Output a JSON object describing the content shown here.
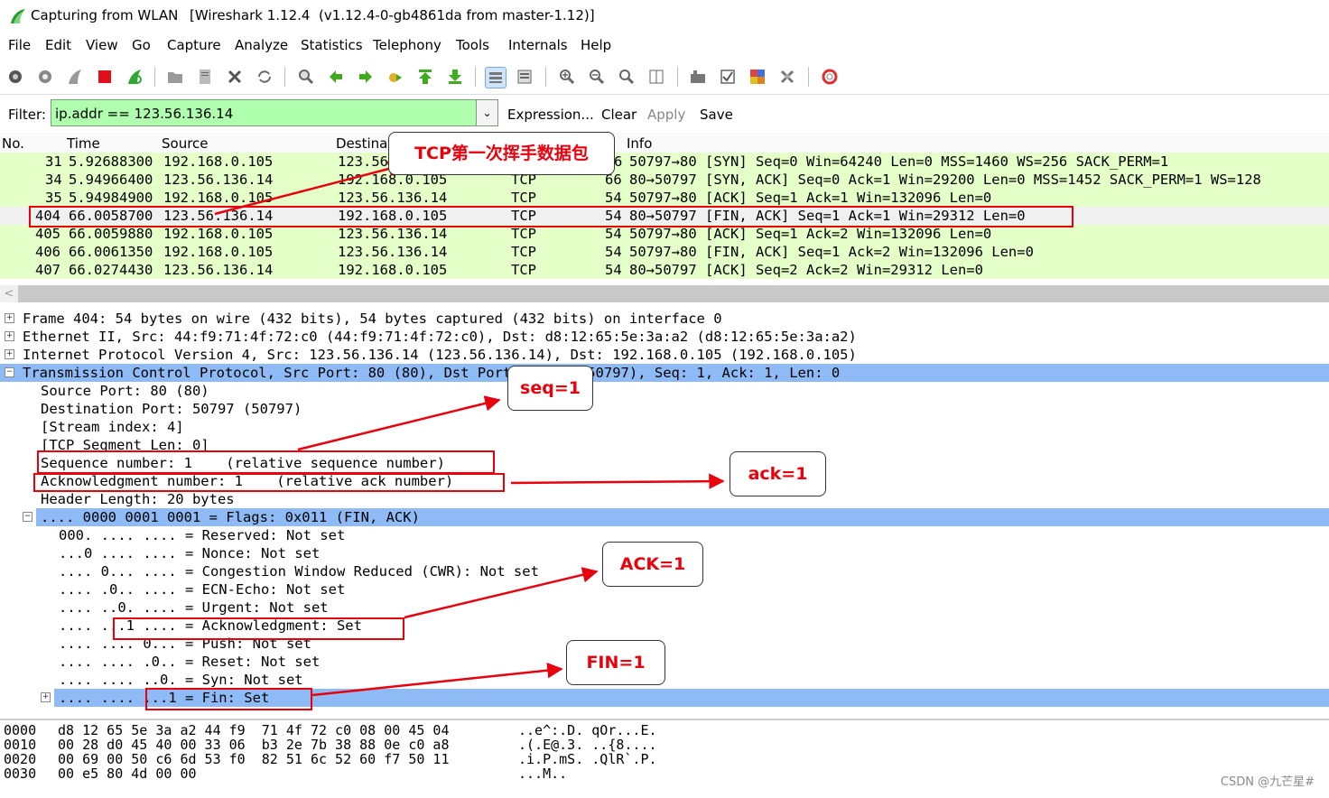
{
  "window": {
    "title_left": "Capturing from WLAN",
    "title_right": "[Wireshark 1.12.4  (v1.12.4-0-gb4861da from master-1.12)]"
  },
  "menu": [
    "File",
    "Edit",
    "View",
    "Go",
    "Capture",
    "Analyze",
    "Statistics",
    "Telephony",
    "Tools",
    "Internals",
    "Help"
  ],
  "filter": {
    "label": "Filter:",
    "value": "ip.addr == 123.56.136.14",
    "links": [
      "Expression...",
      "Clear",
      "Apply",
      "Save"
    ]
  },
  "packet_list": {
    "headers": [
      "No.",
      "Time",
      "Source",
      "Destinat",
      "Info"
    ],
    "rows": [
      {
        "no": "31",
        "time": "5.92688300",
        "src": "192.168.0.105",
        "dst": "123.56",
        "proto": "",
        "len": "6",
        "info": "50797→80 [SYN] Seq=0 Win=64240 Len=0 MSS=1460 WS=256 SACK_PERM=1"
      },
      {
        "no": "34",
        "time": "5.94966400",
        "src": "123.56.136.14",
        "dst": "192.168.0.105",
        "proto": "TCP",
        "len": "66",
        "info": "80→50797 [SYN, ACK] Seq=0 Ack=1 Win=29200 Len=0 MSS=1452 SACK_PERM=1 WS=128"
      },
      {
        "no": "35",
        "time": "5.94984900",
        "src": "192.168.0.105",
        "dst": "123.56.136.14",
        "proto": "TCP",
        "len": "54",
        "info": "50797→80 [ACK] Seq=1 Ack=1 Win=132096 Len=0"
      },
      {
        "no": "404",
        "time": "66.0058700",
        "src": "123.56.136.14",
        "dst": "192.168.0.105",
        "proto": "TCP",
        "len": "54",
        "info": "80→50797 [FIN, ACK] Seq=1 Ack=1 Win=29312 Len=0"
      },
      {
        "no": "405",
        "time": "66.0059880",
        "src": "192.168.0.105",
        "dst": "123.56.136.14",
        "proto": "TCP",
        "len": "54",
        "info": "50797→80 [ACK] Seq=1 Ack=2 Win=132096 Len=0"
      },
      {
        "no": "406",
        "time": "66.0061350",
        "src": "192.168.0.105",
        "dst": "123.56.136.14",
        "proto": "TCP",
        "len": "54",
        "info": "50797→80 [FIN, ACK] Seq=1 Ack=2 Win=132096 Len=0"
      },
      {
        "no": "407",
        "time": "66.0274430",
        "src": "123.56.136.14",
        "dst": "192.168.0.105",
        "proto": "TCP",
        "len": "54",
        "info": "80→50797 [ACK] Seq=2 Ack=2 Win=29312 Len=0"
      }
    ]
  },
  "details": [
    {
      "text": "Frame 404: 54 bytes on wire (432 bits), 54 bytes captured (432 bits) on interface 0",
      "expander": "+"
    },
    {
      "text": "Ethernet II, Src: 44:f9:71:4f:72:c0 (44:f9:71:4f:72:c0), Dst: d8:12:65:5e:3a:a2 (d8:12:65:5e:3a:a2)",
      "expander": "+"
    },
    {
      "text": "Internet Protocol Version 4, Src: 123.56.136.14 (123.56.136.14), Dst: 192.168.0.105 (192.168.0.105)",
      "expander": "+"
    },
    {
      "text": "Transmission Control Protocol, Src Port: 80 (80), Dst Port: 50797 (50797), Seq: 1, Ack: 1, Len: 0",
      "expander": "−"
    },
    {
      "text": "Source Port: 80 (80)"
    },
    {
      "text": "Destination Port: 50797 (50797)"
    },
    {
      "text": "[Stream index: 4]"
    },
    {
      "text": "[TCP Segment Len: 0]"
    },
    {
      "text": "Sequence number: 1    (relative sequence number)"
    },
    {
      "text": "Acknowledgment number: 1    (relative ack number)"
    },
    {
      "text": "Header Length: 20 bytes"
    },
    {
      "text": ".... 0000 0001 0001 = Flags: 0x011 (FIN, ACK)",
      "expander": "−"
    },
    {
      "text": "000. .... .... = Reserved: Not set"
    },
    {
      "text": "...0 .... .... = Nonce: Not set"
    },
    {
      "text": ".... 0... .... = Congestion Window Reduced (CWR): Not set"
    },
    {
      "text": ".... .0.. .... = ECN-Echo: Not set"
    },
    {
      "text": ".... ..0. .... = Urgent: Not set"
    },
    {
      "text": ".... ...1 .... = Acknowledgment: Set"
    },
    {
      "text": ".... .... 0... = Push: Not set"
    },
    {
      "text": ".... .... .0.. = Reset: Not set"
    },
    {
      "text": ".... .... ..0. = Syn: Not set"
    },
    {
      "text": ".... .... ...1 = Fin: Set",
      "expander": "+"
    }
  ],
  "bytes": [
    {
      "off": "0000",
      "hex": "d8 12 65 5e 3a a2 44 f9  71 4f 72 c0 08 00 45 04",
      "ascii": "..e^:.D. qOr...E."
    },
    {
      "off": "0010",
      "hex": "00 28 d0 45 40 00 33 06  b3 2e 7b 38 88 0e c0 a8",
      "ascii": ".(.E@.3. ..{8...."
    },
    {
      "off": "0020",
      "hex": "00 69 00 50 c6 6d 53 f0  82 51 6c 52 60 f7 50 11",
      "ascii": ".i.P.mS. .QlR`.P."
    },
    {
      "off": "0030",
      "hex": "00 e5 80 4d 00 00",
      "ascii": "...M.."
    }
  ],
  "annotations": {
    "tcp_callout": "TCP第一次挥手数据包",
    "seq_callout": "seq=1",
    "ack_callout": "ack=1",
    "ackflag_callout": "ACK=1",
    "fin_callout": "FIN=1",
    "color": "#e8000d"
  },
  "watermark": "CSDN @九芒星#",
  "colors": {
    "tcp_row": "#e4ffc7",
    "selected_row": "#f0f0f0",
    "filter_bg": "#afffaf",
    "tree_highlight": "#8ebbf6"
  }
}
